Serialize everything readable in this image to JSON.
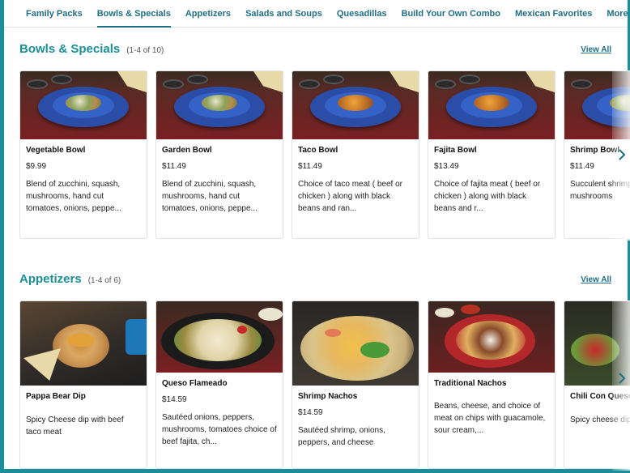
{
  "nav": {
    "items": [
      {
        "label": "Family Packs",
        "active": false
      },
      {
        "label": "Bowls & Specials",
        "active": true
      },
      {
        "label": "Appetizers",
        "active": false
      },
      {
        "label": "Salads and Soups",
        "active": false
      },
      {
        "label": "Quesadillas",
        "active": false
      },
      {
        "label": "Build Your Own Combo",
        "active": false
      },
      {
        "label": "Mexican Favorites",
        "active": false
      }
    ],
    "more_label": "More",
    "more_icon": "chevron-down-icon"
  },
  "sections": [
    {
      "title": "Bowls & Specials",
      "count": "(1-4 of 10)",
      "view_all": "View All",
      "next_icon": "chevron-right-icon",
      "items": [
        {
          "name": "Vegetable Bowl",
          "price": "$9.99",
          "desc": "Blend of zucchini, squash, mushrooms, hand cut tomatoes, onions, peppe..."
        },
        {
          "name": "Garden Bowl",
          "price": "$11.49",
          "desc": "Blend of zucchini, squash, mushrooms, hand cut tomatoes, onions, peppe..."
        },
        {
          "name": "Taco Bowl",
          "price": "$11.49",
          "desc": "Choice of taco meat ( beef or chicken ) along with black beans and ran..."
        },
        {
          "name": "Fajita Bowl",
          "price": "$13.49",
          "desc": "Choice of fajita meat ( beef or chicken ) along with black beans and r..."
        },
        {
          "name": "Shrimp Bowl",
          "price": "$11.49",
          "desc": "Succulent shrimp with zucchini, mushrooms"
        }
      ]
    },
    {
      "title": "Appetizers",
      "count": "(1-4 of 6)",
      "view_all": "View All",
      "next_icon": "chevron-right-icon",
      "items": [
        {
          "name": "Pappa Bear Dip",
          "price": "",
          "desc": "Spicy Cheese dip with beef taco meat"
        },
        {
          "name": "Queso Flameado",
          "price": "$14.59",
          "desc": "Sautéed onions, peppers, mushrooms, tomatoes choice of beef fajita, ch..."
        },
        {
          "name": "Shrimp Nachos",
          "price": "$14.59",
          "desc": "Sautéed shrimp, onions, peppers, and cheese"
        },
        {
          "name": "Traditional Nachos",
          "price": "",
          "desc": "Beans, cheese, and choice of meat on chips with guacamole, sour cream,..."
        },
        {
          "name": "Chili Con Queso",
          "price": "",
          "desc": "Spicy cheese dip"
        }
      ]
    }
  ],
  "colors": {
    "accent": "#1a8f9a",
    "nav_text": "#1f6f86"
  }
}
